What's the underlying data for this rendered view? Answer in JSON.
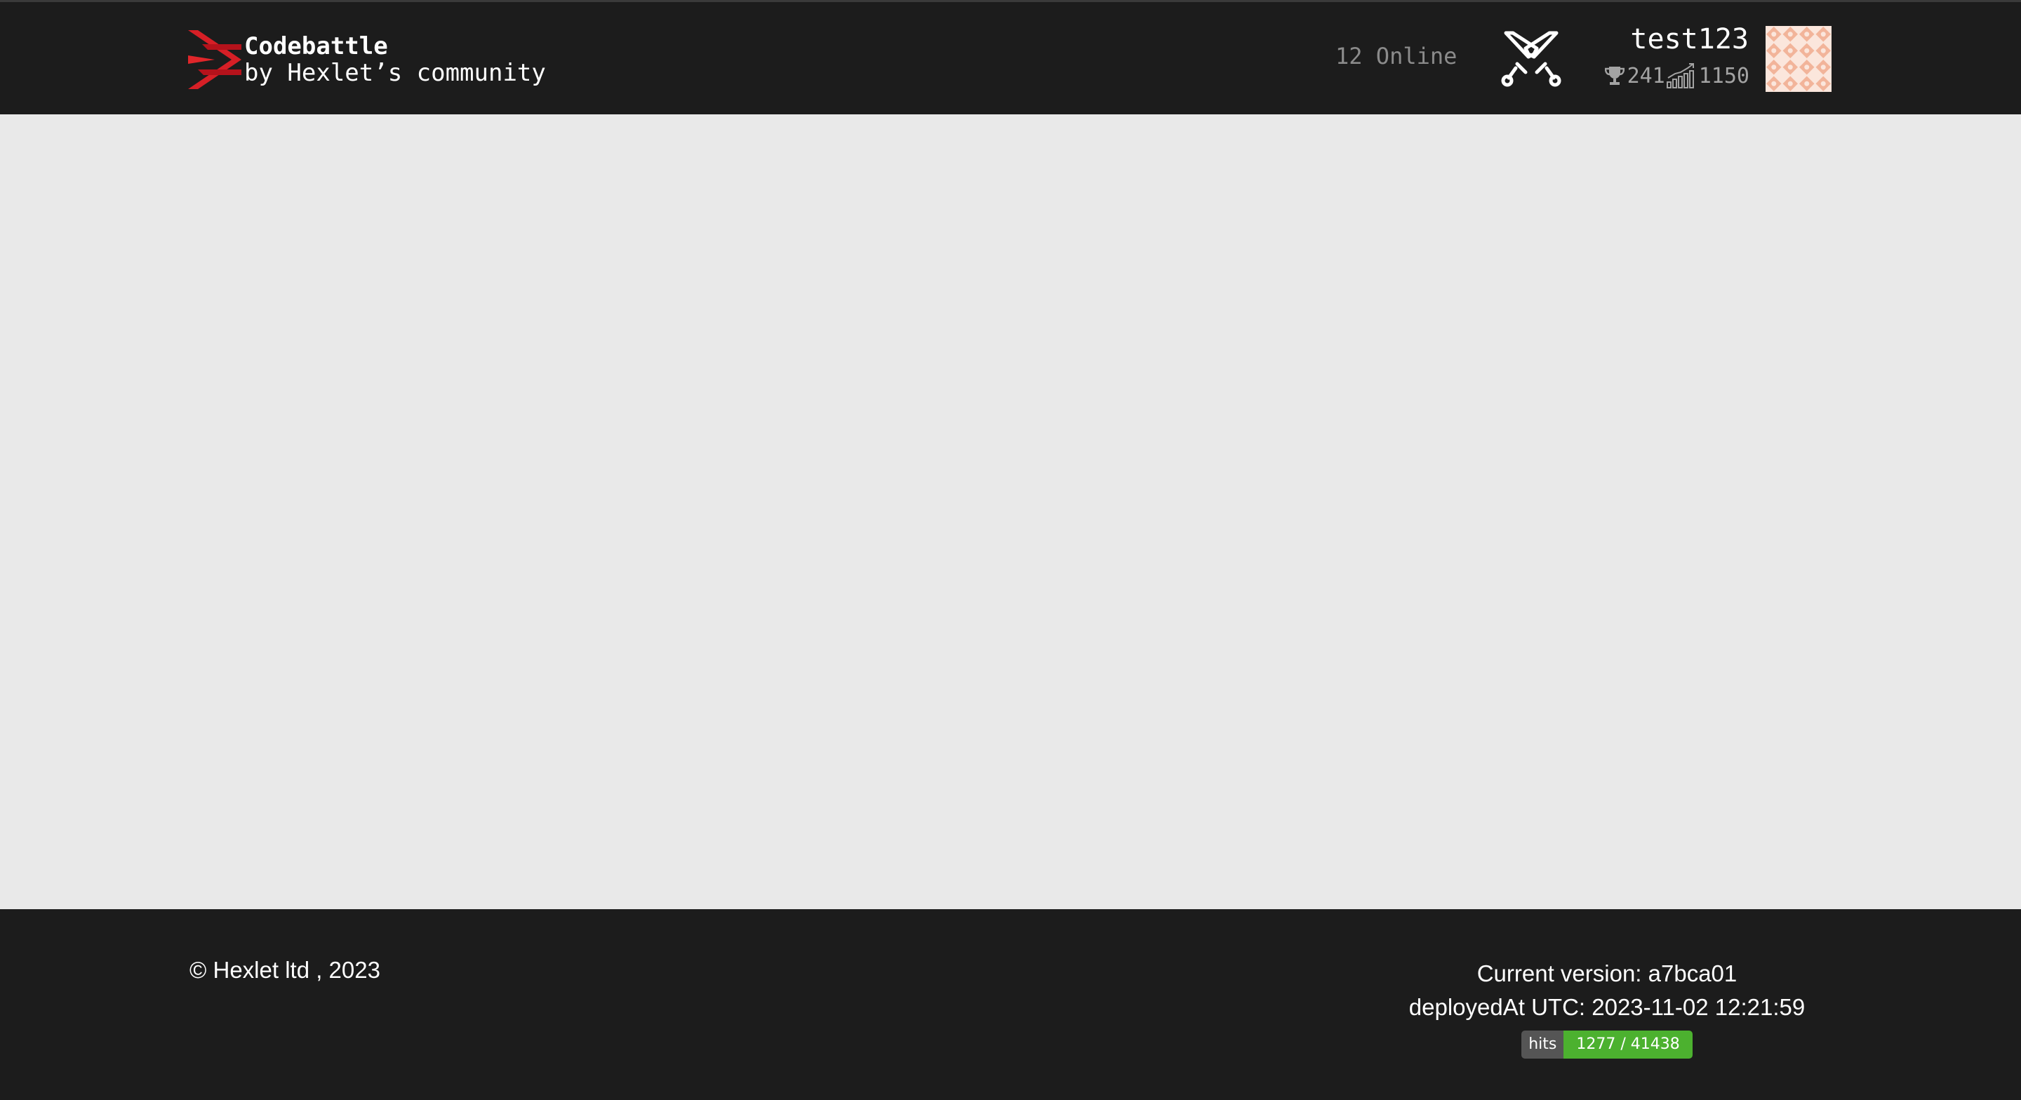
{
  "header": {
    "brand_title": "Codebattle",
    "brand_subtitle": "by Hexlet’s community",
    "online": "12 Online",
    "swords_icon": "crossed-swords-icon"
  },
  "user": {
    "name": "test123",
    "trophy_icon": "trophy-icon",
    "rank": "241",
    "rating_icon": "rating-chart-icon",
    "rating": "1150"
  },
  "footer": {
    "copyright": "© Hexlet ltd , 2023",
    "version": "Current version: a7bca01",
    "deployed": "deployedAt UTC: 2023-11-02 12:21:59",
    "hits_label": "hits",
    "hits_value": "1277 / 41438"
  },
  "colors": {
    "bar_bg": "#1c1c1c",
    "page_bg": "#e9e9e9",
    "logo_red": "#e0262a",
    "hits_green": "#4cb12f",
    "avatar_tint": "#f2b49a"
  }
}
